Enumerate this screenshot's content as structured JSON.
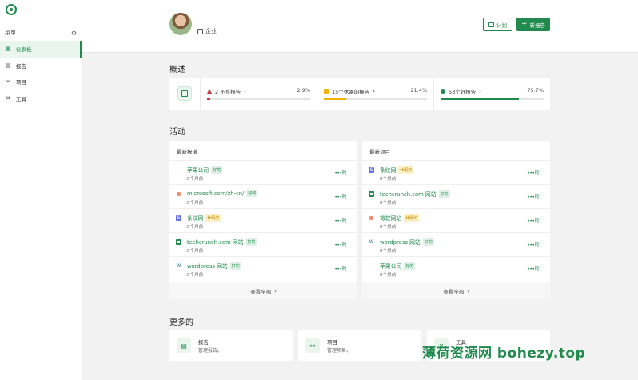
{
  "sidebar": {
    "menu_label": "菜单",
    "items": [
      {
        "label": "仪表板",
        "icon": "dashboard-icon",
        "active": true
      },
      {
        "label": "报告",
        "icon": "report-icon",
        "active": false
      },
      {
        "label": "项目",
        "icon": "project-icon",
        "active": false
      },
      {
        "label": "工具",
        "icon": "tools-icon",
        "active": false
      }
    ]
  },
  "header": {
    "company": "企业",
    "plan_label": "计划",
    "new_report_label": "新报告"
  },
  "overview": {
    "title": "概述",
    "stats": [
      {
        "label": "2 不良报告",
        "chevron": "›",
        "pct": "2.9%",
        "value": 0.029,
        "color": "#d0343a"
      },
      {
        "label": "15个休眠的报告",
        "chevron": "›",
        "pct": "21.4%",
        "value": 0.214,
        "color": "#f0b400"
      },
      {
        "label": "53个好报告",
        "chevron": "›",
        "pct": "75.7%",
        "value": 0.757,
        "color": "#1f8a4c"
      }
    ]
  },
  "activity": {
    "title": "活动",
    "reports": {
      "title": "最新报道",
      "rows": [
        {
          "name": "苹果公司",
          "badge": "好的",
          "badge_type": "good",
          "time": "8个月前",
          "icon": "apple-icon"
        },
        {
          "name": "microsoft.com/zh-cn/",
          "badge": "好的",
          "badge_type": "good",
          "time": "8个月前",
          "icon": "microsoft-icon"
        },
        {
          "name": "条纹网",
          "badge": "休眠的",
          "badge_type": "warn",
          "time": "8个月前",
          "icon": "stripe-icon"
        },
        {
          "name": "techcrunch.com 网站",
          "badge": "好的",
          "badge_type": "good",
          "time": "8个月前",
          "icon": "techcrunch-icon"
        },
        {
          "name": "wordpress 网站",
          "badge": "好的",
          "badge_type": "good",
          "time": "8个月前",
          "icon": "wordpress-icon"
        }
      ],
      "view_all": "查看全部"
    },
    "projects": {
      "title": "最新项目",
      "rows": [
        {
          "name": "条纹网",
          "badge": "休眠的",
          "badge_type": "warn",
          "time": "8个月前",
          "icon": "stripe-icon"
        },
        {
          "name": "techcrunch.com 网站",
          "badge": "好的",
          "badge_type": "good",
          "time": "8个月前",
          "icon": "techcrunch-icon"
        },
        {
          "name": "微软网站",
          "badge": "休眠的",
          "badge_type": "warn",
          "time": "8个月前",
          "icon": "microsoft-icon"
        },
        {
          "name": "wordpress 网站",
          "badge": "好的",
          "badge_type": "good",
          "time": "8个月前",
          "icon": "wordpress-icon"
        },
        {
          "name": "苹果公司",
          "badge": "好的",
          "badge_type": "good",
          "time": "8个月前",
          "icon": "apple-icon"
        }
      ],
      "view_all": "查看全部"
    }
  },
  "more": {
    "title": "更多的",
    "cards": [
      {
        "title": "报告",
        "desc": "管理报告。"
      },
      {
        "title": "项目",
        "desc": "管理项目。"
      },
      {
        "title": "工具",
        "desc": ""
      }
    ]
  },
  "watermark": "薄荷资源网 bohezy.top"
}
